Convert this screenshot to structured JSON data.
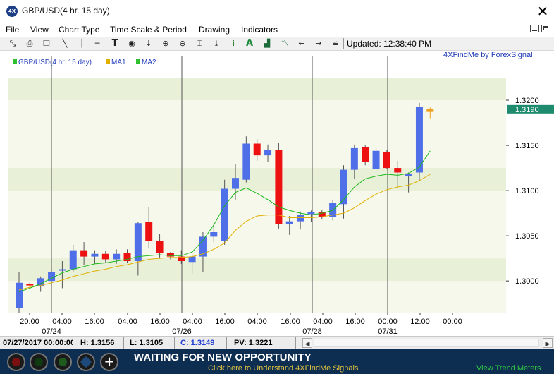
{
  "window": {
    "app_icon_text": "4X",
    "title": "GBP/USD(4 hr.  15 day)"
  },
  "menu": [
    "File",
    "View",
    "Chart Type",
    "Time Scale & Period",
    "Drawing",
    "Indicators"
  ],
  "toolbar": {
    "icons": [
      "select-cursor-icon",
      "print-icon",
      "copy-icon",
      "trendline-icon",
      "vertical-line-icon",
      "horizontal-line-icon",
      "text-tool-icon",
      "point-marker-icon",
      "arrow-down-icon",
      "zoom-in-icon",
      "zoom-out-icon",
      "fit-icon",
      "import-icon",
      "info-icon",
      "font-icon",
      "bar-chart-icon",
      "line-chart-icon",
      "scroll-left-icon",
      "scroll-right-icon",
      "settings-lines-icon"
    ],
    "updated": "Updated: 12:38:40 PM"
  },
  "chart": {
    "brand": "4XFindMe by ForexSignal",
    "legend": [
      {
        "label": "GBP/USD(4 hr.  15 day)",
        "color": "#2a9a2a"
      },
      {
        "label": "MA1",
        "color": "#e0b000"
      },
      {
        "label": "MA2",
        "color": "#2ec02e"
      }
    ],
    "current_price_label": "1.3190",
    "current_price_color": "#1e8a6e"
  },
  "chart_data": {
    "type": "candlestick",
    "y_axis_ticks": [
      "1.3200",
      "1.3150",
      "1.3100",
      "1.3050",
      "1.3000"
    ],
    "ylim": [
      1.2965,
      1.3225
    ],
    "x_tick_labels": [
      "20:00",
      "04:00",
      "16:00",
      "04:00",
      "16:00",
      "04:00",
      "16:00",
      "04:00",
      "16:00",
      "04:00",
      "16:00",
      "00:00",
      "12:00",
      "00:00"
    ],
    "date_labels": [
      "07/24",
      "07/26",
      "07/28",
      "07/31"
    ],
    "up_color": "#4f6fe8",
    "down_color": "#ee1111",
    "candles": [
      {
        "o": 1.297,
        "h": 1.301,
        "l": 1.2965,
        "c": 1.2998
      },
      {
        "o": 1.2997,
        "h": 1.2999,
        "l": 1.2991,
        "c": 1.2995
      },
      {
        "o": 1.2994,
        "h": 1.3005,
        "l": 1.2988,
        "c": 1.3003
      },
      {
        "o": 1.3,
        "h": 1.3014,
        "l": 1.2995,
        "c": 1.301
      },
      {
        "o": 1.3012,
        "h": 1.3022,
        "l": 1.2992,
        "c": 1.3013
      },
      {
        "o": 1.3013,
        "h": 1.304,
        "l": 1.301,
        "c": 1.3034
      },
      {
        "o": 1.3034,
        "h": 1.3043,
        "l": 1.3018,
        "c": 1.3027
      },
      {
        "o": 1.3027,
        "h": 1.3034,
        "l": 1.3019,
        "c": 1.303
      },
      {
        "o": 1.303,
        "h": 1.3033,
        "l": 1.302,
        "c": 1.3024
      },
      {
        "o": 1.3024,
        "h": 1.3035,
        "l": 1.3019,
        "c": 1.303
      },
      {
        "o": 1.3031,
        "h": 1.3035,
        "l": 1.302,
        "c": 1.3022
      },
      {
        "o": 1.3022,
        "h": 1.3065,
        "l": 1.3006,
        "c": 1.3064
      },
      {
        "o": 1.3065,
        "h": 1.3082,
        "l": 1.3036,
        "c": 1.3044
      },
      {
        "o": 1.3044,
        "h": 1.3052,
        "l": 1.3026,
        "c": 1.3031
      },
      {
        "o": 1.3031,
        "h": 1.3032,
        "l": 1.3024,
        "c": 1.3027
      },
      {
        "o": 1.3027,
        "h": 1.3034,
        "l": 1.3019,
        "c": 1.3022
      },
      {
        "o": 1.3021,
        "h": 1.303,
        "l": 1.3008,
        "c": 1.3027
      },
      {
        "o": 1.3027,
        "h": 1.3054,
        "l": 1.301,
        "c": 1.3049
      },
      {
        "o": 1.3049,
        "h": 1.3063,
        "l": 1.3043,
        "c": 1.3054
      },
      {
        "o": 1.3044,
        "h": 1.3112,
        "l": 1.304,
        "c": 1.3102
      },
      {
        "o": 1.3102,
        "h": 1.3129,
        "l": 1.309,
        "c": 1.3114
      },
      {
        "o": 1.3112,
        "h": 1.316,
        "l": 1.3109,
        "c": 1.3152
      },
      {
        "o": 1.3152,
        "h": 1.3157,
        "l": 1.3133,
        "c": 1.3139
      },
      {
        "o": 1.3139,
        "h": 1.3151,
        "l": 1.3132,
        "c": 1.3145
      },
      {
        "o": 1.3145,
        "h": 1.3153,
        "l": 1.3058,
        "c": 1.3063
      },
      {
        "o": 1.3063,
        "h": 1.3072,
        "l": 1.3051,
        "c": 1.3066
      },
      {
        "o": 1.3066,
        "h": 1.3077,
        "l": 1.3057,
        "c": 1.3073
      },
      {
        "o": 1.3074,
        "h": 1.3078,
        "l": 1.3065,
        "c": 1.3076
      },
      {
        "o": 1.3076,
        "h": 1.3079,
        "l": 1.3068,
        "c": 1.3071
      },
      {
        "o": 1.3071,
        "h": 1.309,
        "l": 1.3067,
        "c": 1.3086
      },
      {
        "o": 1.3085,
        "h": 1.3128,
        "l": 1.3069,
        "c": 1.3123
      },
      {
        "o": 1.3123,
        "h": 1.3151,
        "l": 1.3113,
        "c": 1.3147
      },
      {
        "o": 1.3148,
        "h": 1.315,
        "l": 1.3128,
        "c": 1.3132
      },
      {
        "o": 1.3124,
        "h": 1.3148,
        "l": 1.3121,
        "c": 1.3144
      },
      {
        "o": 1.3143,
        "h": 1.3145,
        "l": 1.3124,
        "c": 1.3125
      },
      {
        "o": 1.3125,
        "h": 1.3133,
        "l": 1.3104,
        "c": 1.312
      },
      {
        "o": 1.3117,
        "h": 1.312,
        "l": 1.3098,
        "c": 1.3118
      },
      {
        "o": 1.312,
        "h": 1.3197,
        "l": 1.3111,
        "c": 1.3193
      },
      {
        "o": 1.319,
        "h": 1.3192,
        "l": 1.318,
        "c": 1.3187
      }
    ],
    "ma1": [
      1.299,
      1.2993,
      1.2995,
      1.2998,
      1.3001,
      1.3005,
      1.3008,
      1.3011,
      1.3013,
      1.3016,
      1.3018,
      1.3021,
      1.3024,
      1.3025,
      1.3026,
      1.3026,
      1.3027,
      1.303,
      1.3035,
      1.3042,
      1.3056,
      1.3066,
      1.3072,
      1.3073,
      1.3073,
      1.307,
      1.307,
      1.307,
      1.3071,
      1.3073,
      1.3075,
      1.3081,
      1.3089,
      1.3096,
      1.3101,
      1.3104,
      1.3106,
      1.3111,
      1.3118
    ],
    "ma2": [
      1.2988,
      1.2992,
      1.2997,
      1.3003,
      1.3009,
      1.3013,
      1.3016,
      1.3019,
      1.302,
      1.3022,
      1.3024,
      1.3027,
      1.3028,
      1.3029,
      1.3028,
      1.3028,
      1.3032,
      1.3045,
      1.3062,
      1.3083,
      1.3098,
      1.3103,
      1.3097,
      1.309,
      1.3082,
      1.3078,
      1.3075,
      1.3073,
      1.3075,
      1.3078,
      1.309,
      1.3104,
      1.3113,
      1.3116,
      1.3118,
      1.3117,
      1.3119,
      1.3126,
      1.3144
    ]
  },
  "status": {
    "datetime": "07/27/2017 00:00:00",
    "high": "H: 1.3156",
    "low": "L: 1.3105",
    "close": "C: 1.3149",
    "pv": "PV: 1.3221"
  },
  "bottom": {
    "buttons": [
      {
        "name": "red-signal-button",
        "color": "#d22"
      },
      {
        "name": "green-signal-button",
        "color": "#2a2"
      },
      {
        "name": "trend-radar-button",
        "color": "#3a3"
      },
      {
        "name": "diamond-button",
        "color": "#246"
      },
      {
        "name": "add-button",
        "color": "#fff"
      }
    ],
    "waiting": "WAITING FOR NEW OPPORTUNITY",
    "understand_link": "Click here to Understand 4XFindMe Signals",
    "trend_link": "View Trend Meters"
  }
}
